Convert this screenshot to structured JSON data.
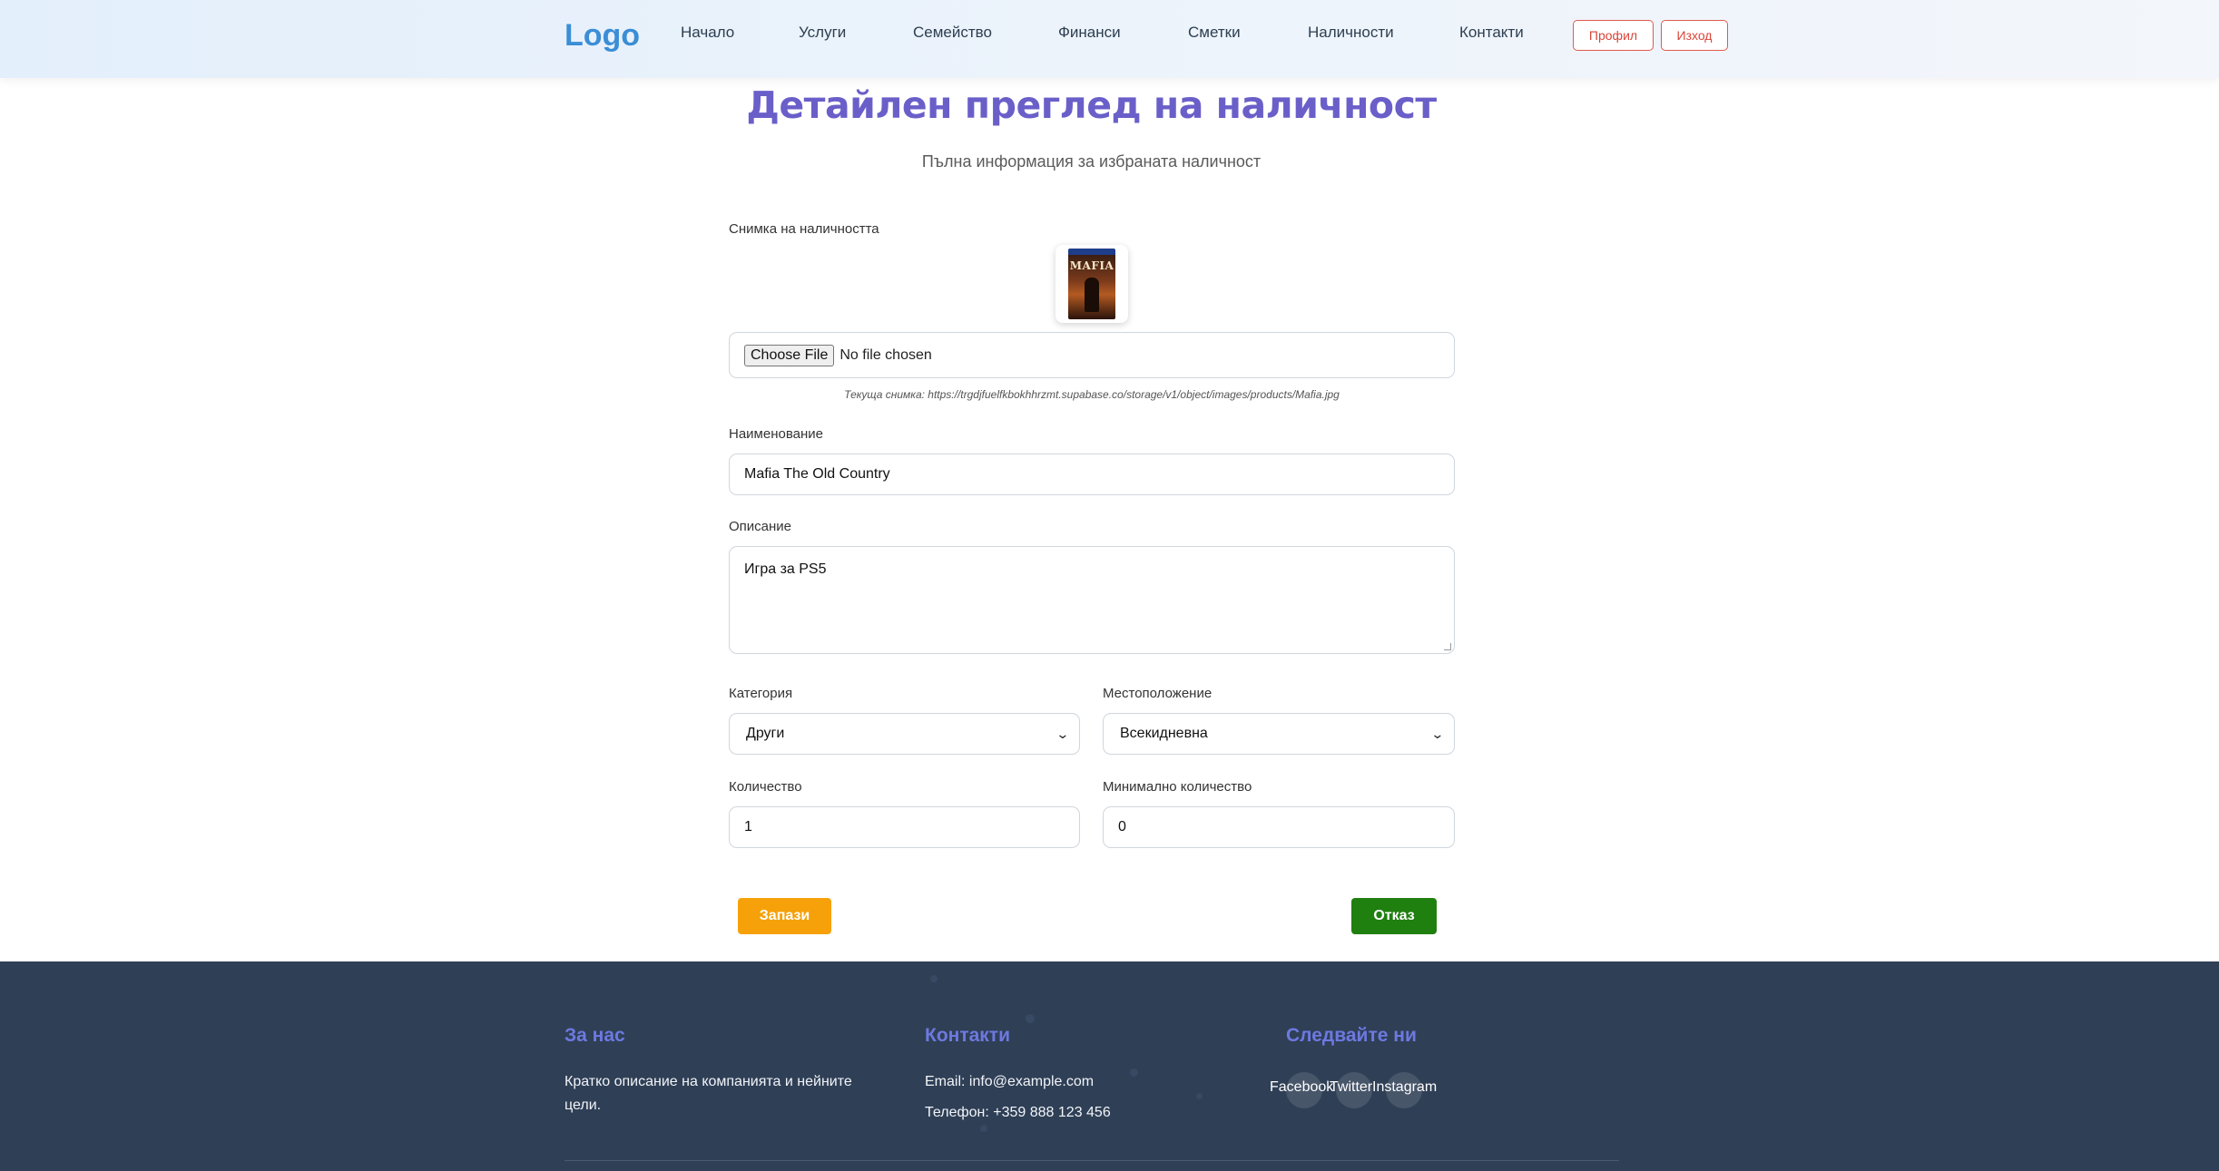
{
  "header": {
    "logo": "Logo",
    "nav": [
      "Начало",
      "Услуги",
      "Семейство",
      "Финанси",
      "Сметки",
      "Наличности",
      "Контакти"
    ],
    "profile_label": "Профил",
    "logout_label": "Изход"
  },
  "page": {
    "title": "Детайлен преглед на наличност",
    "subtitle": "Пълна информация за избраната наличност"
  },
  "form": {
    "photo_label": "Снимка на наличността",
    "photo_cover_text": "MAFIA",
    "file_button": "Choose File",
    "file_status": "No file chosen",
    "current_image": "Текуща снимка: https://trgdjfuelfkbokhhrzmt.supabase.co/storage/v1/object/images/products/Mafia.jpg",
    "name_label": "Наименование",
    "name_value": "Mafia The Old Country",
    "description_label": "Описание",
    "description_value": "Игра за PS5",
    "category_label": "Категория",
    "category_value": "Други",
    "location_label": "Местоположение",
    "location_value": "Всекидневна",
    "quantity_label": "Количество",
    "quantity_value": "1",
    "min_quantity_label": "Минимално количество",
    "min_quantity_value": "0",
    "save_label": "Запази",
    "cancel_label": "Отказ"
  },
  "footer": {
    "about_title": "За нас",
    "about_text": "Кратко описание на компанията и нейните цели.",
    "contacts_title": "Контакти",
    "email": "Email: info@example.com",
    "phone": "Телефон: +359 888 123 456",
    "follow_title": "Следвайте ни",
    "social": [
      "Facebook",
      "Twitter",
      "Instagram"
    ]
  },
  "colors": {
    "accent": "#6a5fc9",
    "logo": "#3b8ed6",
    "save": "#f6a10a",
    "cancel": "#1f7f0f",
    "danger": "#d9453a",
    "footer_bg": "#2f3f56"
  }
}
